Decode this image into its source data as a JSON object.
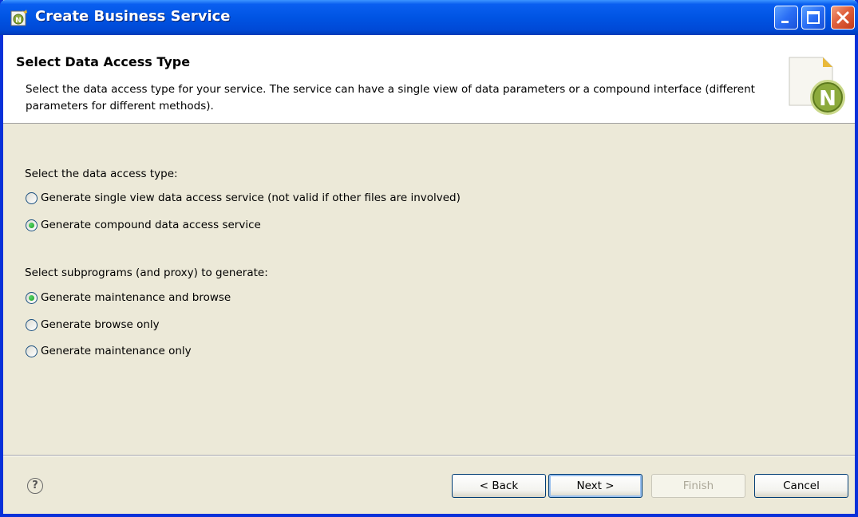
{
  "window": {
    "title": "Create Business Service"
  },
  "header": {
    "title": "Select Data Access Type",
    "description": "Select the data access type for your service. The service can have a single view of data parameters or a compound interface (different parameters for different methods).",
    "logo_letter": "N"
  },
  "access_type": {
    "label": "Select the data access type:",
    "options": [
      {
        "label": "Generate single view data access service (not valid if other files are involved)",
        "selected": false
      },
      {
        "label": "Generate compound data access service",
        "selected": true
      }
    ]
  },
  "subprograms": {
    "label": "Select subprograms (and proxy) to generate:",
    "options": [
      {
        "label": "Generate maintenance and browse",
        "selected": true
      },
      {
        "label": "Generate browse only",
        "selected": false
      },
      {
        "label": "Generate maintenance only",
        "selected": false
      }
    ]
  },
  "buttons": {
    "help": "?",
    "back": "< Back",
    "next": "Next >",
    "finish": "Finish",
    "cancel": "Cancel",
    "finish_enabled": false
  },
  "colors": {
    "titlebar": "#0054e3",
    "window_border": "#0831d9",
    "dialog_bg": "#ece9d8",
    "logo_green": "#8caa3c"
  }
}
